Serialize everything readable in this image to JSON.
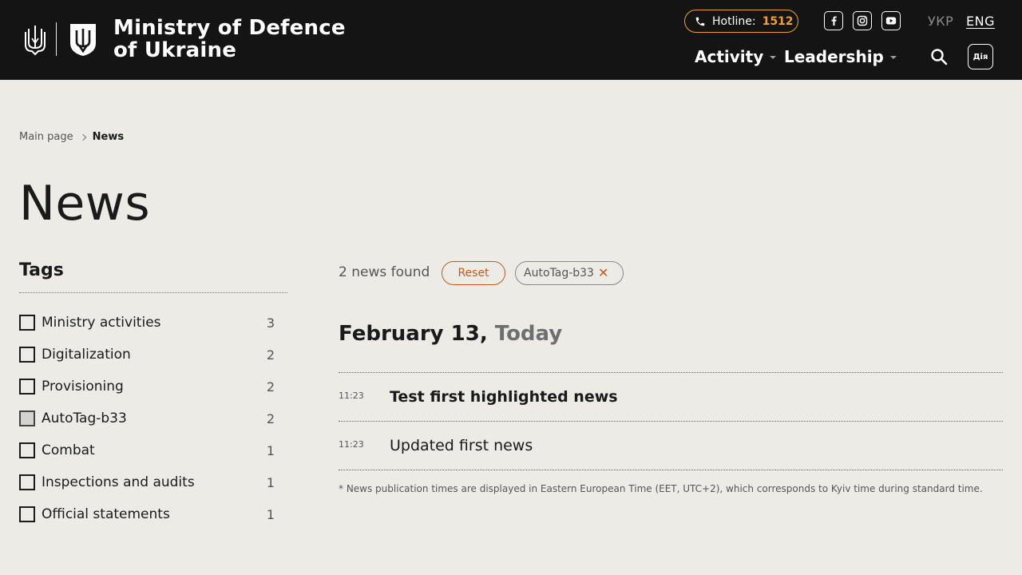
{
  "header": {
    "brand_line1": "Ministry of Defence",
    "brand_line2": "of Ukraine",
    "hotline_label": "Hotline:",
    "hotline_number": "1512",
    "lang_ukr": "УКР",
    "lang_eng": "ENG",
    "nav_activity": "Activity",
    "nav_leadership": "Leadership",
    "diia_label": "Дія",
    "social": [
      "facebook-icon",
      "instagram-icon",
      "youtube-icon"
    ],
    "accent_color": "#f0a030",
    "bg_color": "#141414"
  },
  "breadcrumb": {
    "home": "Main page",
    "current": "News"
  },
  "page_title": "News",
  "tags": {
    "title": "Tags",
    "items": [
      {
        "label": "Ministry activities",
        "count": "3",
        "checked": false
      },
      {
        "label": "Digitalization",
        "count": "2",
        "checked": false
      },
      {
        "label": "Provisioning",
        "count": "2",
        "checked": false
      },
      {
        "label": "AutoTag-b33",
        "count": "2",
        "checked": true
      },
      {
        "label": "Combat",
        "count": "1",
        "checked": false
      },
      {
        "label": "Inspections and audits",
        "count": "1",
        "checked": false
      },
      {
        "label": "Official statements",
        "count": "1",
        "checked": false
      }
    ]
  },
  "results": {
    "found_text": "2 news found",
    "reset_label": "Reset",
    "active_filter": "AutoTag-b33",
    "date_main": "February 13,",
    "date_today": "Today",
    "news": [
      {
        "time": "11:23",
        "title": "Test first highlighted news",
        "highlighted": true
      },
      {
        "time": "11:23",
        "title": "Updated first news",
        "highlighted": false
      }
    ],
    "footnote": "* News publication times are displayed in Eastern European Time (EET, UTC+2), which corresponds to Kyiv time during standard time."
  }
}
